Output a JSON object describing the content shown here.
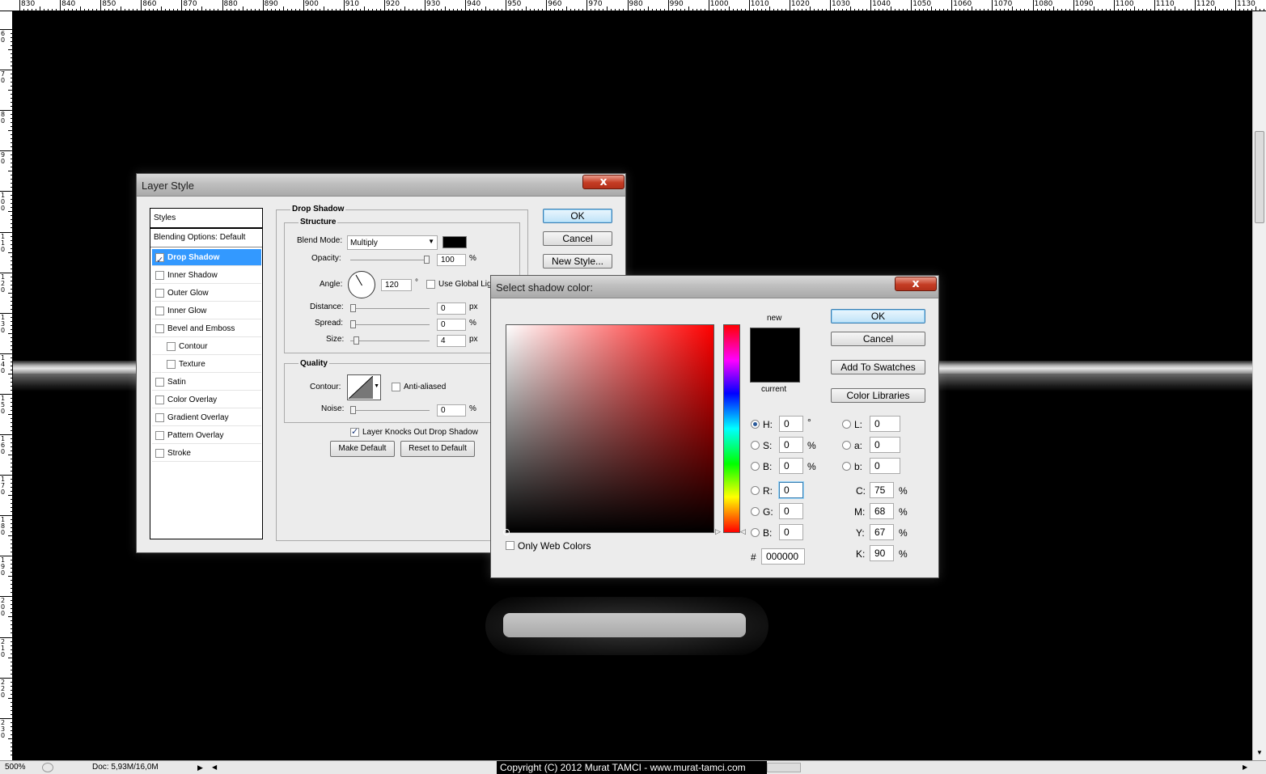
{
  "ruler_top": {
    "labels": [
      "830",
      "840",
      "850",
      "860",
      "870",
      "880",
      "890",
      "900",
      "910",
      "920",
      "930",
      "940",
      "950",
      "960",
      "970",
      "980",
      "990",
      "1000",
      "1010",
      "1020",
      "1030",
      "1040",
      "1050",
      "1060",
      "1070",
      "1080",
      "1090",
      "1100",
      "1110",
      "1120",
      "1130"
    ]
  },
  "ruler_left": {
    "labels": [
      "6 0",
      "7 0",
      "8 0",
      "9 0",
      "1 0 0",
      "1 1 0",
      "1 2 0",
      "1 3 0",
      "1 4 0",
      "1 5 0",
      "1 6 0",
      "1 7 0",
      "1 8 0",
      "1 9 0",
      "2 0 0",
      "2 1 0",
      "2 2 0",
      "2 3 0"
    ]
  },
  "status": {
    "zoom": "500%",
    "doc": "Doc: 5,93M/16,0M",
    "copyright": "Copyright (C) 2012 Murat TAMCI - www.murat-tamci.com"
  },
  "layer_style": {
    "title": "Layer Style",
    "close": "x",
    "styles_header": "Styles",
    "blending_options": "Blending Options: Default",
    "items": [
      {
        "label": "Drop Shadow",
        "checked": true
      },
      {
        "label": "Inner Shadow",
        "checked": false
      },
      {
        "label": "Outer Glow",
        "checked": false
      },
      {
        "label": "Inner Glow",
        "checked": false
      },
      {
        "label": "Bevel and Emboss",
        "checked": false
      },
      {
        "label": "Contour",
        "checked": false
      },
      {
        "label": "Texture",
        "checked": false
      },
      {
        "label": "Satin",
        "checked": false
      },
      {
        "label": "Color Overlay",
        "checked": false
      },
      {
        "label": "Gradient Overlay",
        "checked": false
      },
      {
        "label": "Pattern Overlay",
        "checked": false
      },
      {
        "label": "Stroke",
        "checked": false
      }
    ],
    "ok": "OK",
    "cancel": "Cancel",
    "new_style": "New Style...",
    "section_title": "Drop Shadow",
    "structure": "Structure",
    "blend_mode_label": "Blend Mode:",
    "blend_mode_value": "Multiply",
    "shadow_color": "#000000",
    "opacity_label": "Opacity:",
    "opacity_value": "100",
    "opacity_level": 1.0,
    "angle_label": "Angle:",
    "angle_value": "120",
    "angle_unit": "°",
    "use_global": "Use Global Lig",
    "distance_label": "Distance:",
    "distance_value": "0",
    "spread_label": "Spread:",
    "spread_value": "0",
    "size_label": "Size:",
    "size_value": "4",
    "unit_px": "px",
    "unit_pct": "%",
    "quality": "Quality",
    "contour_label": "Contour:",
    "anti_aliased": "Anti-aliased",
    "noise_label": "Noise:",
    "noise_value": "0",
    "knockout": "Layer Knocks Out Drop Shadow",
    "make_default": "Make Default",
    "reset_default": "Reset to Default"
  },
  "color_picker": {
    "title": "Select shadow color:",
    "close": "x",
    "ok": "OK",
    "cancel": "Cancel",
    "add_swatches": "Add To Swatches",
    "color_libraries": "Color Libraries",
    "new_label": "new",
    "current_label": "current",
    "new_color": "#000000",
    "current_color": "#000000",
    "only_web": "Only Web Colors",
    "fields": {
      "H": "0",
      "S": "0",
      "B": "0",
      "R": "0",
      "G": "0",
      "B2": "0",
      "L": "0",
      "a": "0",
      "b": "0",
      "C": "75",
      "M": "68",
      "Y": "67",
      "K": "90"
    },
    "labels": {
      "H": "H:",
      "S": "S:",
      "B": "B:",
      "R": "R:",
      "G": "G:",
      "B2": "B:",
      "L": "L:",
      "a": "a:",
      "b": "b:",
      "C": "C:",
      "M": "M:",
      "Y": "Y:",
      "K": "K:",
      "hash": "#"
    },
    "units": {
      "deg": "°",
      "pct": "%"
    },
    "hex": "000000"
  }
}
